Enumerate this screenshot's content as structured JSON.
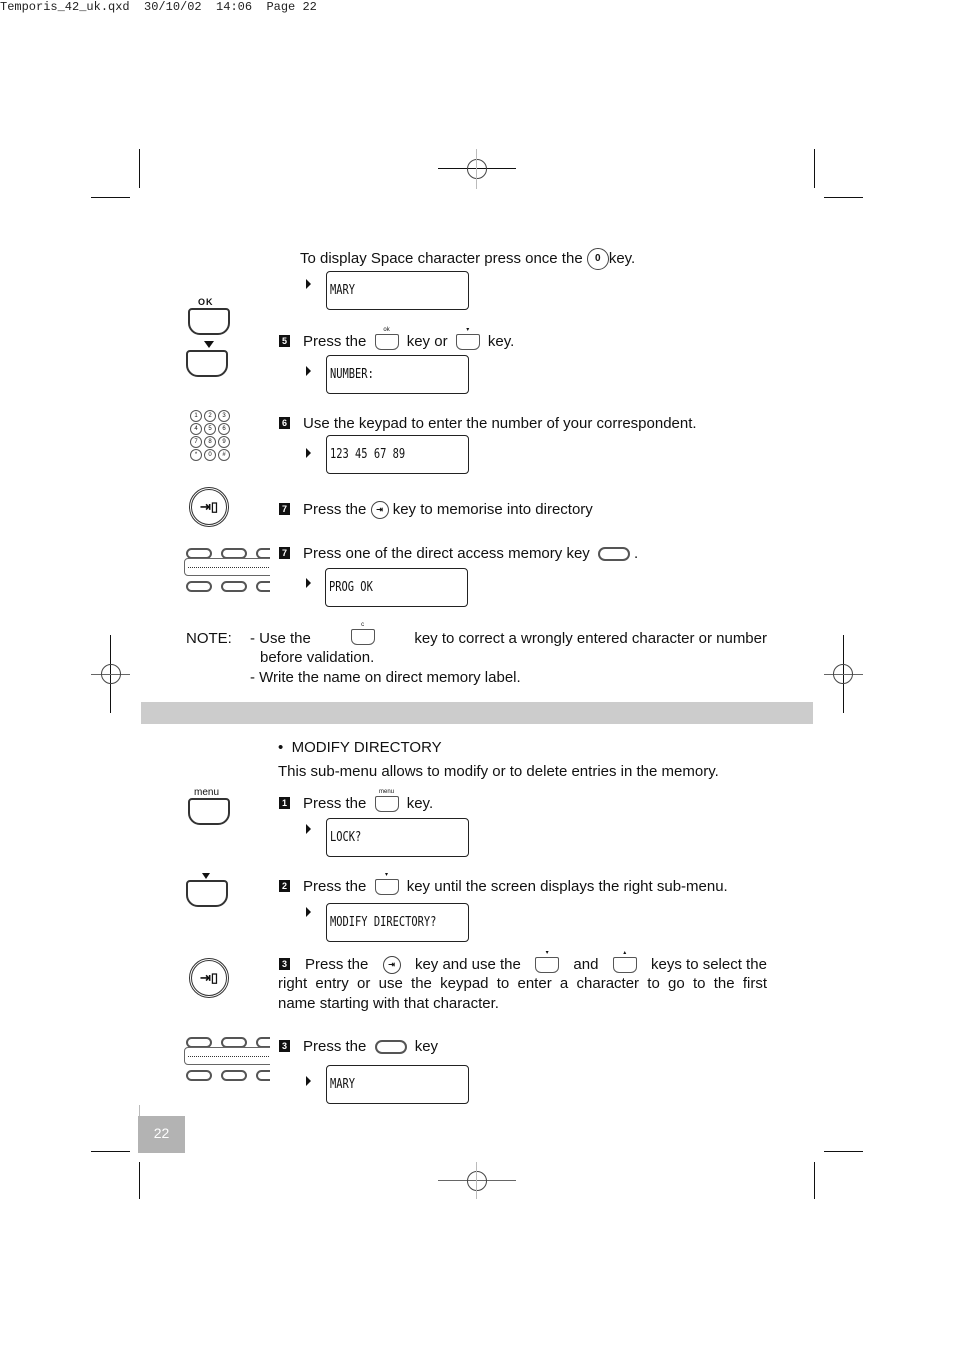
{
  "slug": "Temporis_42_uk.qxd  30/10/02  14:06  Page 22",
  "page_number": "22",
  "section1": {
    "intro": {
      "pre": "To display Space character press once the",
      "key": "0",
      "post": "key."
    },
    "display_mary": "MARY",
    "step5": {
      "num": "5",
      "pre": "Press the",
      "mid": "key or",
      "post": "key.",
      "ok_label": "OK",
      "key_ok_label": "ok"
    },
    "display_number": "NUMBER:",
    "step6": {
      "num": "6",
      "text": "Use the keypad to enter the number of your correspondent."
    },
    "display_phone": "123 45 67 89",
    "step7a": {
      "num": "7",
      "pre": "Press the",
      "post": "key to memorise into directory"
    },
    "step7b": {
      "num": "7",
      "pre": "Press one of the direct access memory key",
      "post": "."
    },
    "display_prog": "PROG OK",
    "note": {
      "label": "NOTE:",
      "line1_pre": "- Use the",
      "line1_post": "key to correct a wrongly entered character or number",
      "line1_cont": "before validation.",
      "line2": "- Write the name on direct memory label.",
      "key_c_label": "c"
    }
  },
  "section2": {
    "bullet": "•",
    "title": "MODIFY DIRECTORY",
    "desc": "This sub-menu allows to modify or to delete entries in the memory.",
    "menu_label": "menu",
    "step1": {
      "num": "1",
      "pre": "Press the",
      "post": "key."
    },
    "display_lock": "LOCK?",
    "step2": {
      "num": "2",
      "pre": "Press the",
      "post": "key until the screen displays the right sub-menu."
    },
    "display_modify": "MODIFY DIRECTORY?",
    "step3a": {
      "num": "3",
      "pre": "Press the",
      "mid1": "key and use the",
      "mid2": "and",
      "post": "keys to select the",
      "line2": "right entry or use the keypad to enter a character to go to the first",
      "line3": "name starting with that character."
    },
    "step3b": {
      "num": "3",
      "pre": "Press the",
      "post": "key"
    },
    "display_mary": "MARY"
  },
  "keypad_keys": [
    "1",
    "2",
    "3",
    "4",
    "5",
    "6",
    "7",
    "8",
    "9",
    "*",
    "0",
    "#"
  ]
}
